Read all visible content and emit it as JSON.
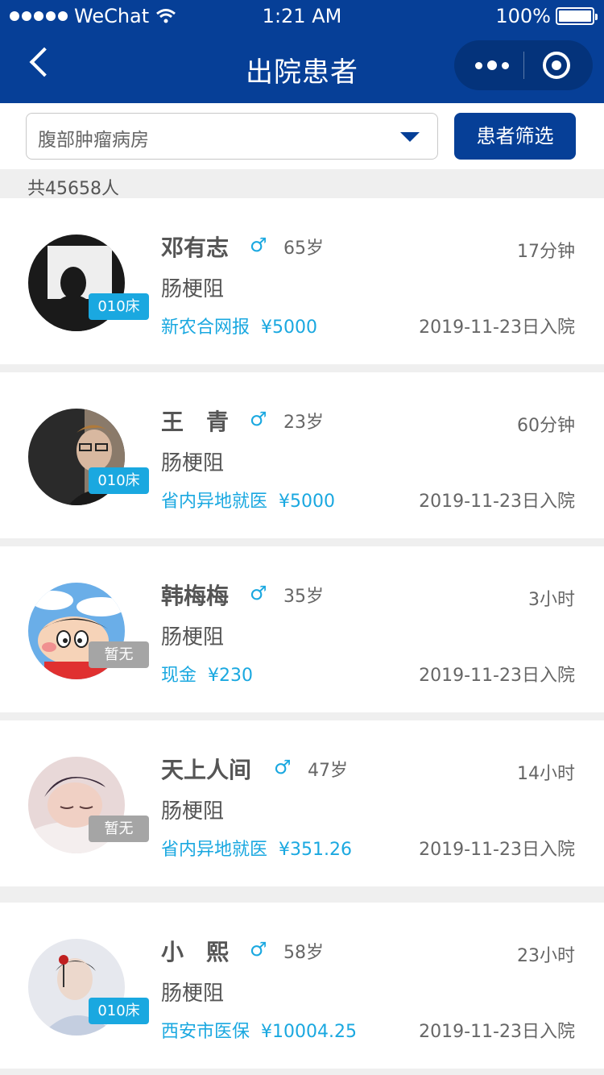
{
  "status_bar": {
    "carrier": "WeChat",
    "time": "1:21 AM",
    "battery": "100%"
  },
  "nav": {
    "title": "出院患者"
  },
  "filter": {
    "department": "腹部肿瘤病房",
    "button_label": "患者筛选"
  },
  "summary": {
    "count_text": "共45658人"
  },
  "patients": [
    {
      "name": "邓有志",
      "gender": "♂",
      "age": "65岁",
      "diagnosis": "肠梗阻",
      "insurance": "新农合网报",
      "amount": "¥5000",
      "elapsed": "17分钟",
      "admit": "2019-11-23日入院",
      "bed": "010床"
    },
    {
      "name": "王　青",
      "gender": "♂",
      "age": "23岁",
      "diagnosis": "肠梗阻",
      "insurance": "省内异地就医",
      "amount": "¥5000",
      "elapsed": "60分钟",
      "admit": "2019-11-23日入院",
      "bed": "010床"
    },
    {
      "name": "韩梅梅",
      "gender": "♂",
      "age": "35岁",
      "diagnosis": "肠梗阻",
      "insurance": "现金",
      "amount": "¥230",
      "elapsed": "3小时",
      "admit": "2019-11-23日入院",
      "bed": "暂无"
    },
    {
      "name": "天上人间",
      "gender": "♂",
      "age": "47岁",
      "diagnosis": "肠梗阻",
      "insurance": "省内异地就医",
      "amount": "¥351.26",
      "elapsed": "14小时",
      "admit": "2019-11-23日入院",
      "bed": "暂无"
    },
    {
      "name": "小　熙",
      "gender": "♂",
      "age": "58岁",
      "diagnosis": "肠梗阻",
      "insurance": "西安市医保",
      "amount": "¥10004.25",
      "elapsed": "23小时",
      "admit": "2019-11-23日入院",
      "bed": "010床"
    }
  ]
}
